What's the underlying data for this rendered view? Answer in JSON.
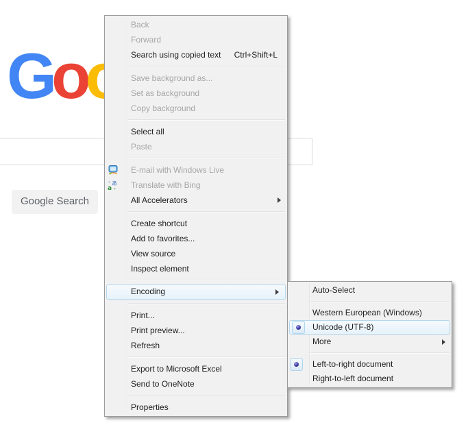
{
  "page": {
    "logo_letters": [
      {
        "char": "G",
        "style": "color:#4285F4"
      },
      {
        "char": "o",
        "style": "color:#EA4335"
      },
      {
        "char": "o",
        "style": "color:#FBBC05"
      }
    ],
    "search_input": {
      "value": ""
    },
    "buttons": {
      "google_search": "Google Search"
    }
  },
  "colors": {
    "menu_face": "#f1f1f1",
    "menu_border": "#9b9b9b",
    "highlight_border": "#b5d7ec",
    "highlight_fill": "#e6f2fa",
    "disabled_text": "#a6a6a6",
    "google_blue": "#4285F4",
    "google_red": "#EA4335",
    "google_yellow": "#FBBC05"
  },
  "context_menu": {
    "items": [
      {
        "label": "Back",
        "state": "disabled"
      },
      {
        "label": "Forward",
        "state": "disabled"
      },
      {
        "label": "Search using copied text",
        "shortcut": "Ctrl+Shift+L",
        "state": "enabled"
      },
      {
        "label": "Save background as...",
        "state": "disabled"
      },
      {
        "label": "Set as background",
        "state": "disabled"
      },
      {
        "label": "Copy background",
        "state": "disabled"
      },
      {
        "label": "Select all",
        "state": "enabled"
      },
      {
        "label": "Paste",
        "state": "disabled"
      },
      {
        "label": "E-mail with Windows Live",
        "state": "disabled",
        "icon": "windows-live-mail-icon"
      },
      {
        "label": "Translate with Bing",
        "state": "disabled",
        "icon": "bing-translate-icon"
      },
      {
        "label": "All Accelerators",
        "state": "enabled",
        "has_submenu": true
      },
      {
        "label": "Create shortcut",
        "state": "enabled"
      },
      {
        "label": "Add to favorites...",
        "state": "enabled"
      },
      {
        "label": "View source",
        "state": "enabled"
      },
      {
        "label": "Inspect element",
        "state": "enabled"
      },
      {
        "label": "Encoding",
        "state": "highlighted",
        "has_submenu": true
      },
      {
        "label": "Print...",
        "state": "enabled"
      },
      {
        "label": "Print preview...",
        "state": "enabled"
      },
      {
        "label": "Refresh",
        "state": "enabled"
      },
      {
        "label": "Export to Microsoft Excel",
        "state": "enabled"
      },
      {
        "label": "Send to OneNote",
        "state": "enabled"
      },
      {
        "label": "Properties",
        "state": "enabled"
      }
    ]
  },
  "encoding_submenu": {
    "items": [
      {
        "label": "Auto-Select"
      },
      {
        "label": "Western European (Windows)"
      },
      {
        "label": "Unicode (UTF-8)",
        "selected": true,
        "state": "highlighted"
      },
      {
        "label": "More",
        "has_submenu": true
      },
      {
        "label": "Left-to-right document",
        "selected": true
      },
      {
        "label": "Right-to-left document"
      }
    ]
  }
}
